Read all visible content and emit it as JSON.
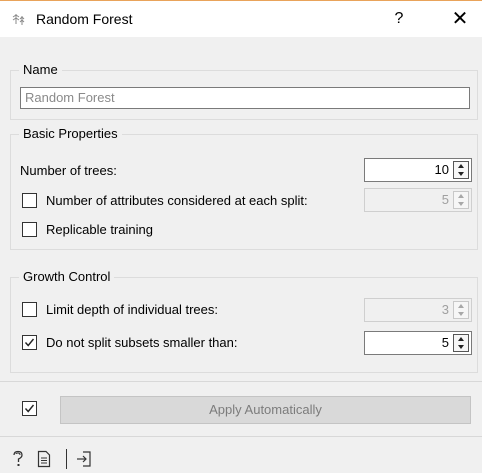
{
  "window": {
    "title": "Random Forest",
    "help_glyph": "?",
    "close_glyph": "✕"
  },
  "name_group": {
    "title": "Name",
    "name_value": "Random Forest"
  },
  "basic_group": {
    "title": "Basic Properties",
    "num_trees_label": "Number of trees:",
    "num_trees_value": "10",
    "num_attrs_label": "Number of attributes considered at each split:",
    "num_attrs_checked": false,
    "num_attrs_value": "5",
    "replicable_label": "Replicable training",
    "replicable_checked": false
  },
  "growth_group": {
    "title": "Growth Control",
    "limit_depth_label": "Limit depth of individual trees:",
    "limit_depth_checked": false,
    "limit_depth_value": "3",
    "min_split_label": "Do not split subsets smaller than:",
    "min_split_checked": true,
    "min_split_value": "5"
  },
  "apply": {
    "auto_checked": true,
    "button_label": "Apply Automatically"
  },
  "statusbar": {
    "icons": [
      "help-icon",
      "report-icon",
      "output-icon"
    ]
  }
}
